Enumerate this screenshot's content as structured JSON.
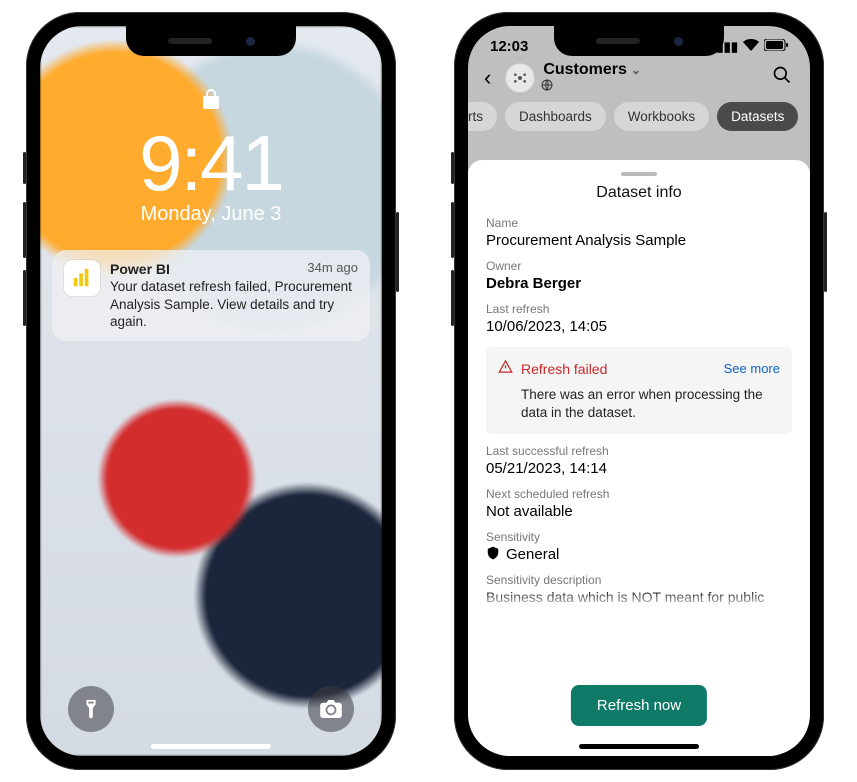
{
  "phone1": {
    "time": "9:41",
    "date": "Monday, June 3",
    "notification": {
      "app": "Power BI",
      "age": "34m ago",
      "body": "Your dataset refresh failed, Procurement Analysis Sample. View details and try again."
    }
  },
  "phone2": {
    "status_time": "12:03",
    "workspace": "Customers",
    "tabs": {
      "t0": "rts",
      "t1": "Dashboards",
      "t2": "Workbooks",
      "t3": "Datasets"
    },
    "sheet": {
      "title": "Dataset info",
      "labels": {
        "name": "Name",
        "owner": "Owner",
        "last_refresh": "Last refresh",
        "last_success": "Last successful refresh",
        "next_scheduled": "Next scheduled refresh",
        "sensitivity": "Sensitivity",
        "sens_desc": "Sensitivity description"
      },
      "name": "Procurement Analysis Sample",
      "owner": "Debra Berger",
      "last_refresh": "10/06/2023, 14:05",
      "error": {
        "title": "Refresh failed",
        "see_more": "See more",
        "desc": "There was an error when processing the data in the dataset."
      },
      "last_success": "05/21/2023, 14:14",
      "next_scheduled": "Not available",
      "sensitivity": "General",
      "sens_desc": "Business data which is NOT meant for public",
      "refresh_btn": "Refresh now"
    }
  }
}
